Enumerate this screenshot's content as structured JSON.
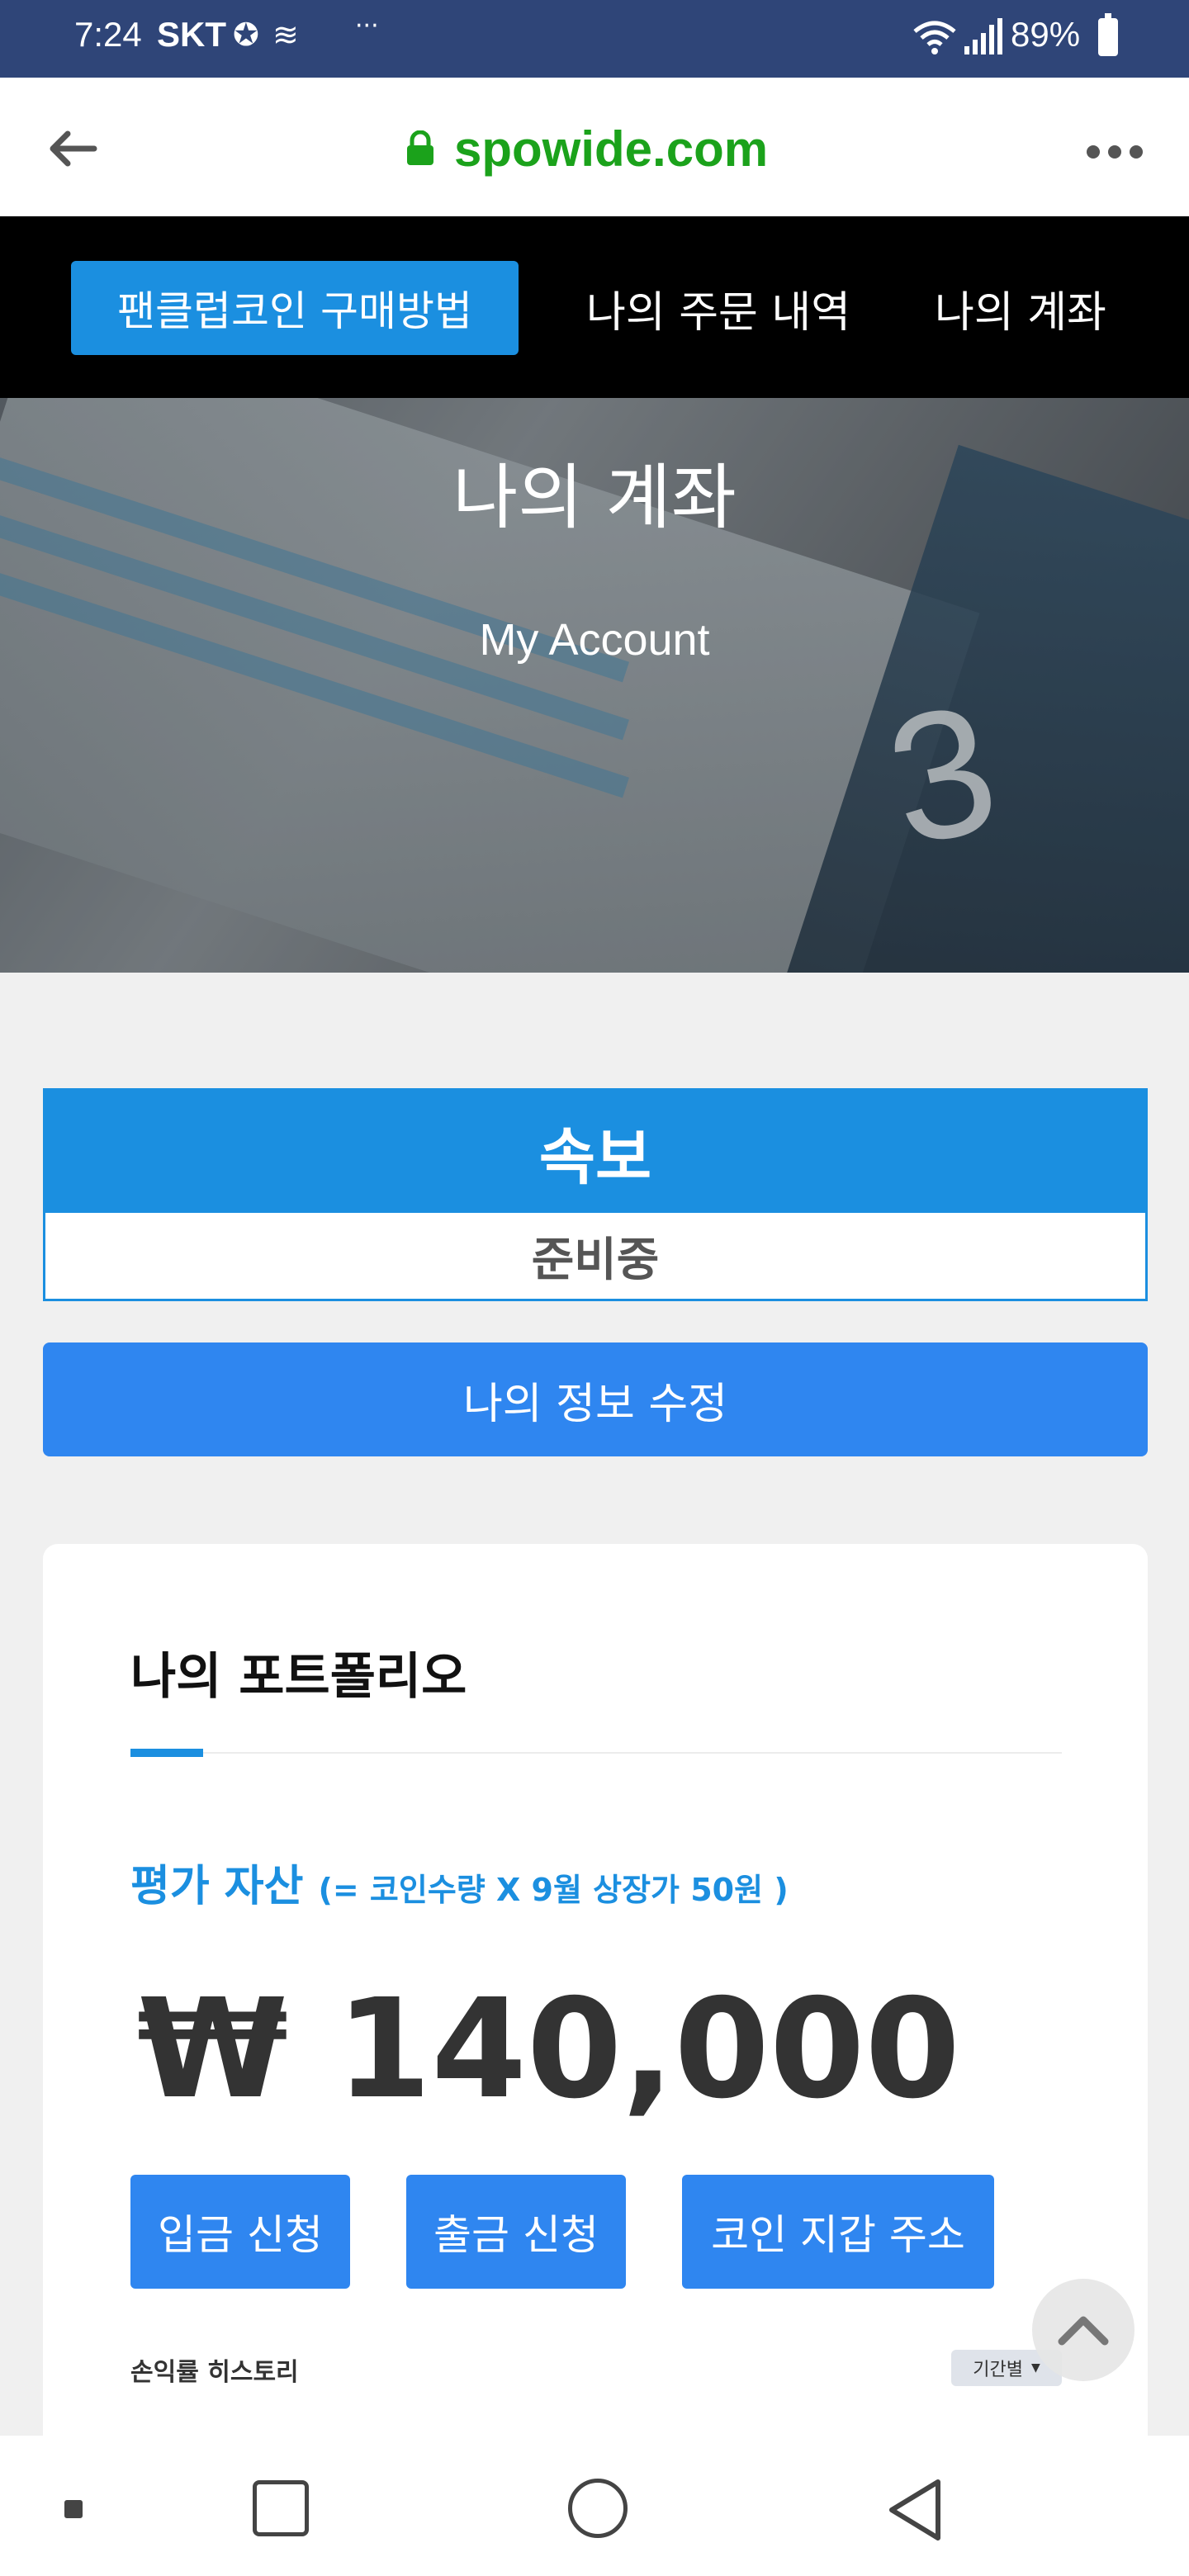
{
  "status_bar": {
    "time": "7:24",
    "carrier": "SKT",
    "extra": "···",
    "battery": "89%"
  },
  "browser": {
    "url": "spowide.com"
  },
  "nav": {
    "active": "팬클럽코인 구매방법",
    "items": [
      "나의 주문 내역",
      "나의 계좌"
    ]
  },
  "hero": {
    "title": "나의 계좌",
    "subtitle": "My Account"
  },
  "news": {
    "heading": "속보",
    "body": "준비중"
  },
  "edit_profile_label": "나의 정보 수정",
  "portfolio": {
    "title": "나의 포트폴리오",
    "eval_label": "평가 자산",
    "eval_note": "(= 코인수량 X 9월 상장가 50원 )",
    "amount": "₩ 140,000",
    "buttons": [
      "입금 신청",
      "출금 신청",
      "코인 지갑 주소"
    ],
    "history_label": "손익률 히스토리",
    "period_label": "기간별"
  },
  "colors": {
    "accent": "#1b8fe0",
    "button_blue": "#2f86f0",
    "status_bar": "#2f4578",
    "url_green": "#1ba21b"
  }
}
